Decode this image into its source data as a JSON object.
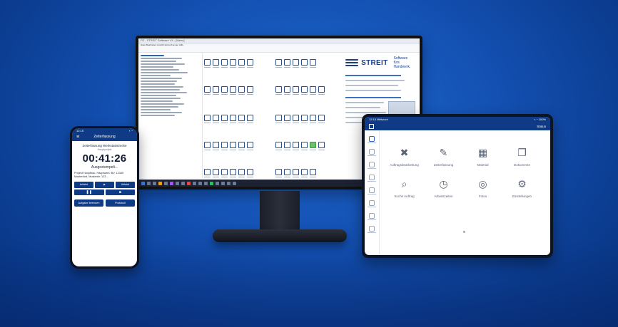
{
  "desktop": {
    "window_title": "FE - STREIT Software V4 - [Menu]",
    "menu_text": "Datei Bearbeiten Ansicht Extras Fenster Hilfe",
    "brand": {
      "name": "STREIT",
      "tagline_1": "Software",
      "tagline_2": "fürs Handwerk."
    }
  },
  "phone": {
    "status_time": "12:15",
    "status_icons": "▪ ◔",
    "title": "Zeiterfassung",
    "subtitle": "Zeiterfassung Werkstattstrecke",
    "subtitle2": "Hauptprojekt",
    "timer": "00:41:26",
    "state": "Ausgestempelt...",
    "description": "Projekt Hauptbau, Hauptwerk: BV, 12345 Musterdorf, Musterstr. 123 ..."
  },
  "phone_controls": {
    "left": "Anfahrt",
    "right": "Abfahrt",
    "play": "▶",
    "pause": "❚❚",
    "stop": "■"
  },
  "phone_actions": {
    "a1": "Aufgabe beenden",
    "a2": "Protokoll"
  },
  "tablet": {
    "status_left": "12:15 Mittwoch",
    "status_right": "▪ ◔ 100%",
    "header_right": "Status",
    "tiles": [
      {
        "label": "Auftragsbearbeitung",
        "icon": "✖"
      },
      {
        "label": "Zeiterfassung",
        "icon": "✎"
      },
      {
        "label": "Material",
        "icon": "▦"
      },
      {
        "label": "Dokumente",
        "icon": "❐"
      },
      {
        "label": "Suche Auftrag",
        "icon": "⌕"
      },
      {
        "label": "Arbeitszeiten",
        "icon": "◷"
      },
      {
        "label": "Fotos",
        "icon": "◎"
      },
      {
        "label": "Einstellungen",
        "icon": "⚙"
      }
    ]
  }
}
